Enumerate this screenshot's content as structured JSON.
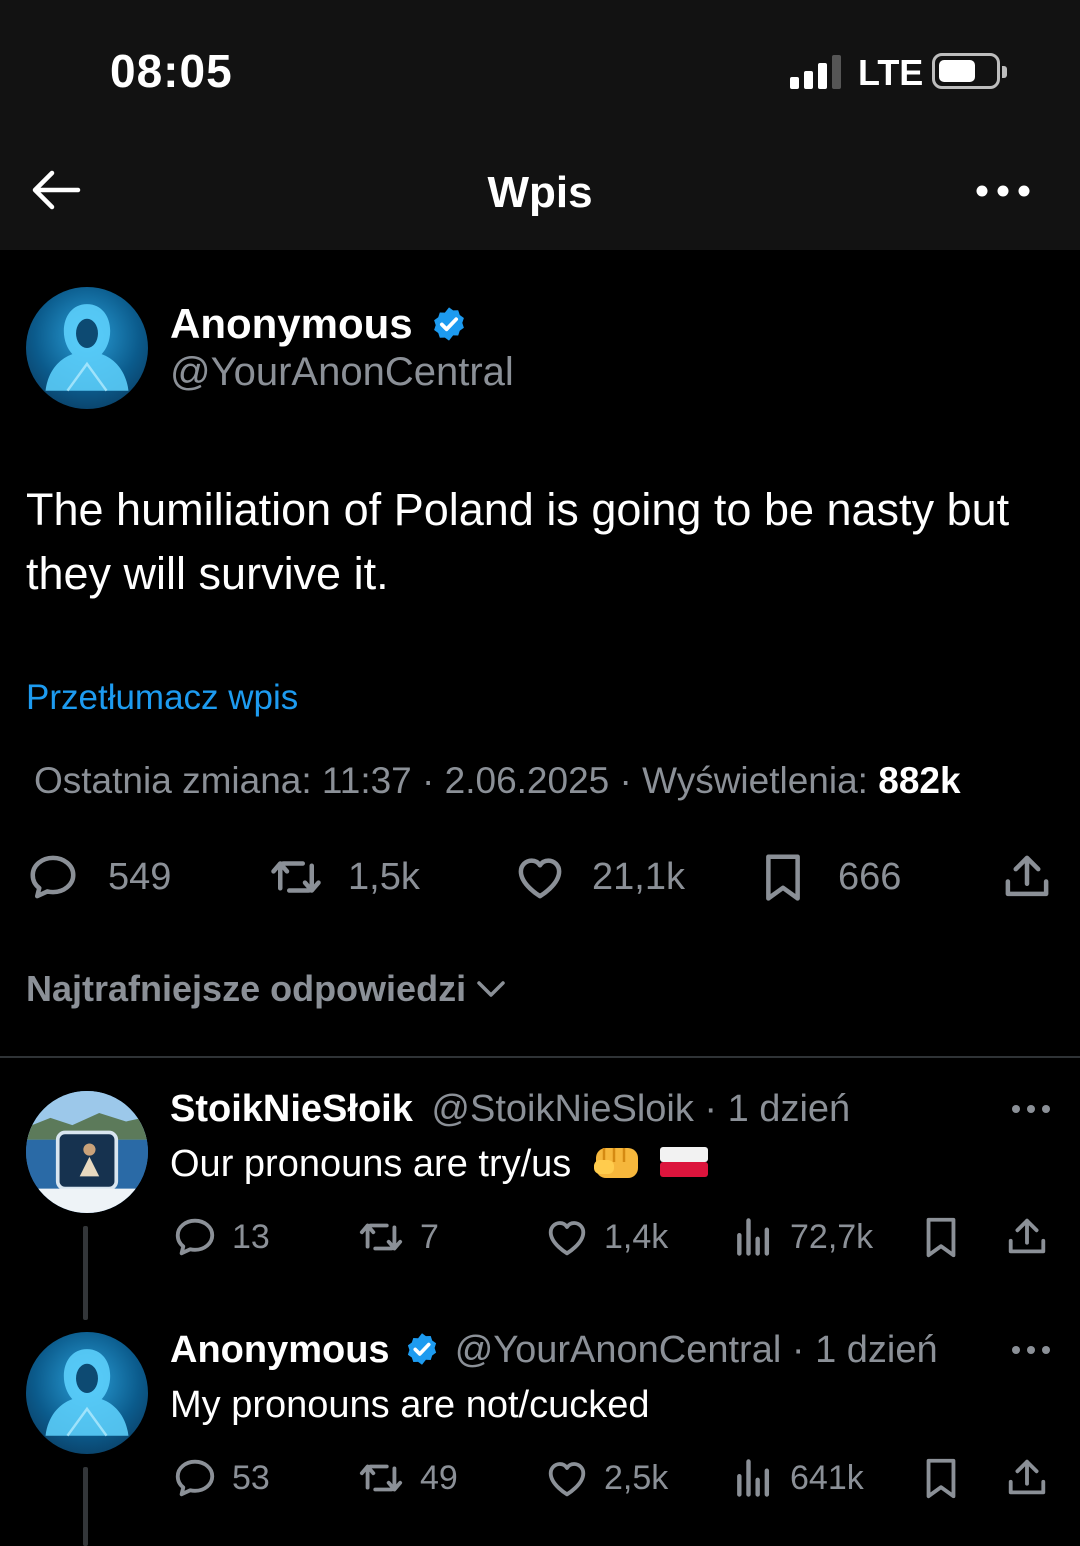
{
  "status": {
    "time": "08:05",
    "network": "LTE"
  },
  "nav": {
    "title": "Wpis",
    "back_icon": "arrow-left-icon",
    "more_icon": "more-horizontal-icon"
  },
  "post": {
    "author": {
      "name": "Anonymous",
      "handle": "@YourAnonCentral",
      "verified": true
    },
    "text": "The humiliation of Poland is going to be nasty but they will survive it.",
    "translate_label": "Przetłumacz wpis",
    "edited_label": "Ostatnia zmiana: 11:37 · 2.06.2025",
    "views_label": "· Wyświetlenia:",
    "views_value": "882k",
    "stats": {
      "replies": "549",
      "reposts": "1,5k",
      "likes": "21,1k",
      "bookmarks": "666"
    }
  },
  "replies_sort": {
    "label": "Najtrafniejsze odpowiedzi"
  },
  "replies": [
    {
      "name": "StoikNieSłoik",
      "handle": "@StoikNieSloik",
      "time": "· 1 dzień",
      "verified": false,
      "text": "Our pronouns are try/us",
      "emojis": [
        "raised-fist-emoji",
        "poland-flag-emoji"
      ],
      "stats": {
        "replies": "13",
        "reposts": "7",
        "likes": "1,4k",
        "views": "72,7k"
      }
    },
    {
      "name": "Anonymous",
      "handle": "@YourAnonCentral",
      "time": "· 1 dzień",
      "verified": true,
      "text": "My pronouns are not/cucked",
      "stats": {
        "replies": "53",
        "reposts": "49",
        "likes": "2,5k",
        "views": "641k"
      }
    }
  ],
  "colors": {
    "accent": "#1d9bf0",
    "background": "#000000",
    "secondary_text": "#8b9097",
    "bar": "#121212"
  }
}
